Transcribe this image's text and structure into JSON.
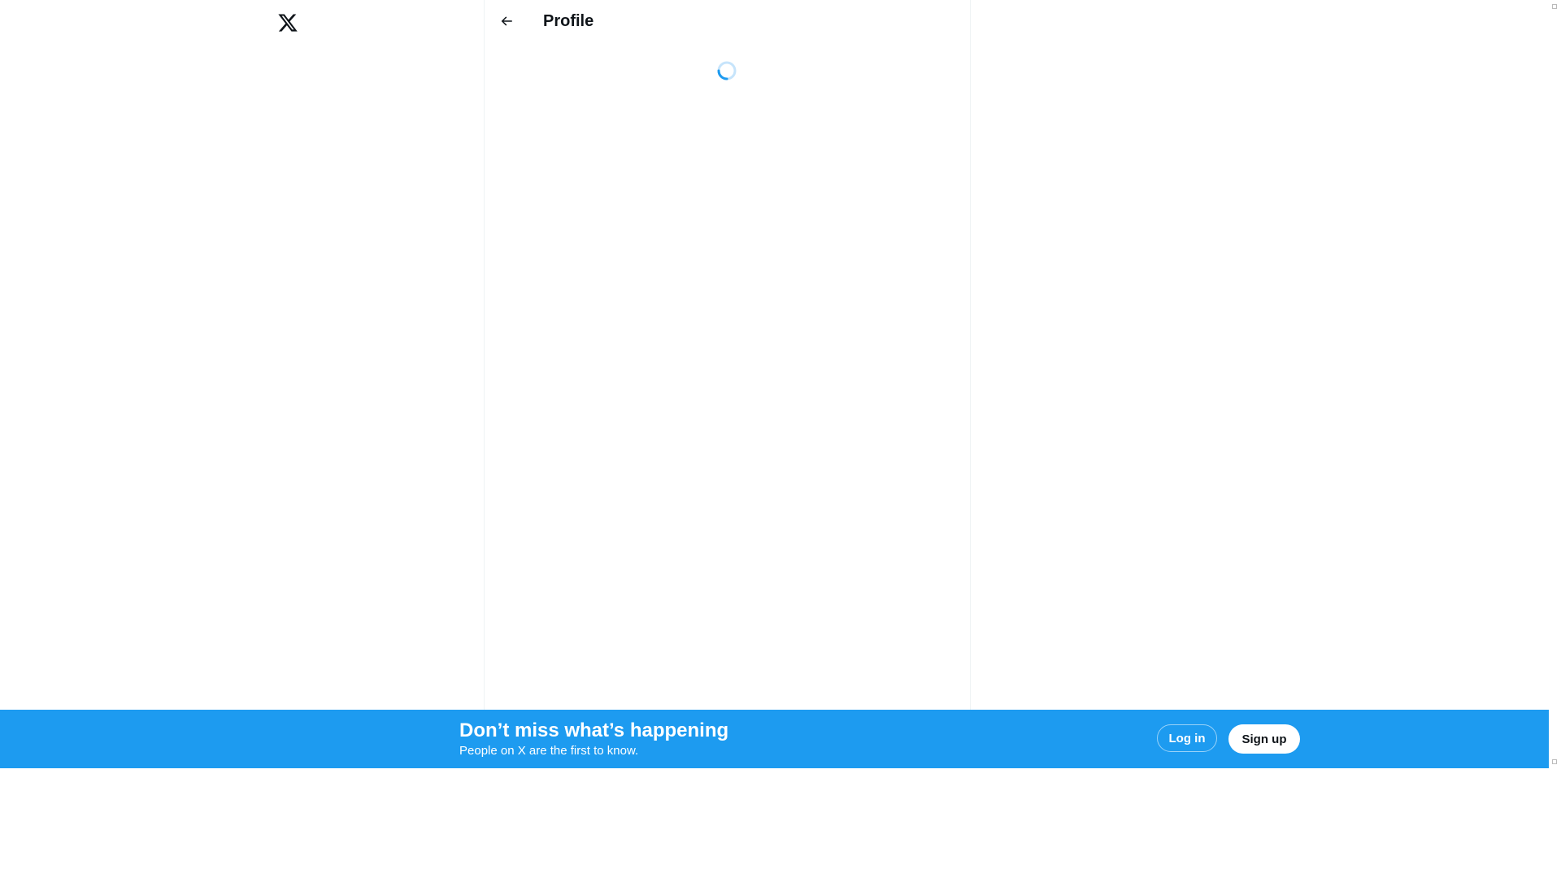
{
  "app": {
    "logo_icon": "x-logo-icon"
  },
  "header": {
    "back_icon": "arrow-left-icon",
    "title": "Profile"
  },
  "main": {
    "loading_icon": "loading-spinner-icon"
  },
  "bottom_bar": {
    "headline": "Don’t miss what’s happening",
    "subtext": "People on X are the first to know.",
    "login_label": "Log in",
    "signup_label": "Sign up"
  },
  "colors": {
    "accent": "#1d9bf0",
    "text": "#0f1419",
    "border": "#eff3f4"
  }
}
